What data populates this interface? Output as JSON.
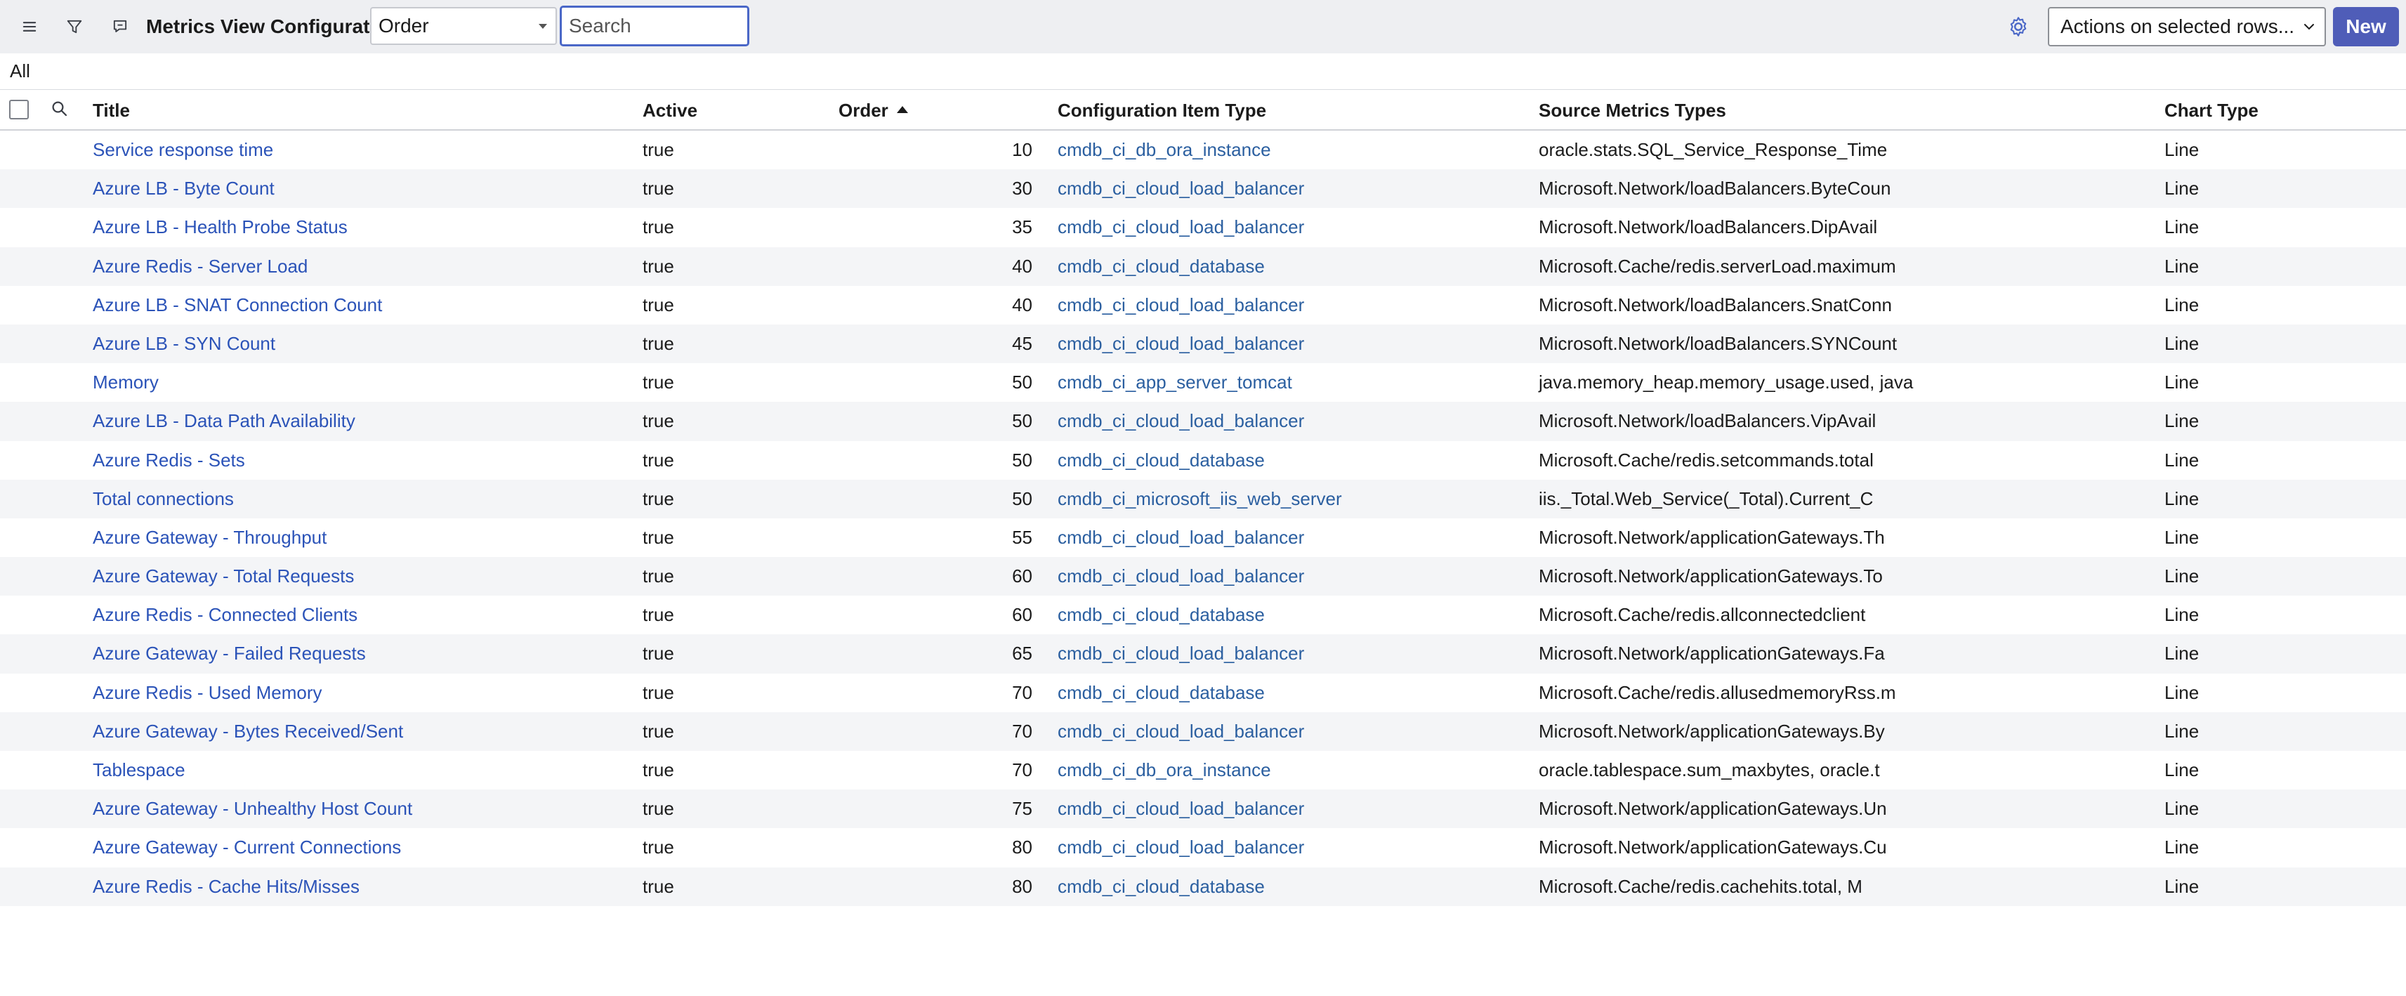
{
  "toolbar": {
    "list_title": "Metrics View Configuration",
    "search_field": "Order",
    "search_placeholder": "Search",
    "actions_label": "Actions on selected rows...",
    "new_label": "New"
  },
  "breadcrumb": "All",
  "columns": {
    "title": "Title",
    "active": "Active",
    "order": "Order",
    "ci_type": "Configuration Item Type",
    "source_metrics": "Source Metrics Types",
    "chart_type": "Chart Type"
  },
  "colors": {
    "accent": "#4f5db8",
    "link": "#2b53b8",
    "toolbar_bg": "#eeeff2",
    "row_alt": "#f4f5f7"
  },
  "rows": [
    {
      "title": "Service response time",
      "active": "true",
      "order": "10",
      "ci_type": "cmdb_ci_db_ora_instance",
      "source": "oracle.stats.SQL_Service_Response_Time",
      "chart": "Line"
    },
    {
      "title": "Azure LB - Byte Count",
      "active": "true",
      "order": "30",
      "ci_type": "cmdb_ci_cloud_load_balancer",
      "source": "Microsoft.Network/loadBalancers.ByteCoun",
      "chart": "Line"
    },
    {
      "title": "Azure LB - Health Probe Status",
      "active": "true",
      "order": "35",
      "ci_type": "cmdb_ci_cloud_load_balancer",
      "source": "Microsoft.Network/loadBalancers.DipAvail",
      "chart": "Line"
    },
    {
      "title": "Azure Redis - Server Load",
      "active": "true",
      "order": "40",
      "ci_type": "cmdb_ci_cloud_database",
      "source": "Microsoft.Cache/redis.serverLoad.maximum",
      "chart": "Line"
    },
    {
      "title": "Azure LB - SNAT Connection Count",
      "active": "true",
      "order": "40",
      "ci_type": "cmdb_ci_cloud_load_balancer",
      "source": "Microsoft.Network/loadBalancers.SnatConn",
      "chart": "Line"
    },
    {
      "title": "Azure LB - SYN Count",
      "active": "true",
      "order": "45",
      "ci_type": "cmdb_ci_cloud_load_balancer",
      "source": "Microsoft.Network/loadBalancers.SYNCount",
      "chart": "Line"
    },
    {
      "title": "Memory",
      "active": "true",
      "order": "50",
      "ci_type": "cmdb_ci_app_server_tomcat",
      "source": "java.memory_heap.memory_usage.used, java",
      "chart": "Line"
    },
    {
      "title": "Azure LB - Data Path Availability",
      "active": "true",
      "order": "50",
      "ci_type": "cmdb_ci_cloud_load_balancer",
      "source": "Microsoft.Network/loadBalancers.VipAvail",
      "chart": "Line"
    },
    {
      "title": "Azure Redis - Sets",
      "active": "true",
      "order": "50",
      "ci_type": "cmdb_ci_cloud_database",
      "source": "Microsoft.Cache/redis.setcommands.total",
      "chart": "Line"
    },
    {
      "title": "Total connections",
      "active": "true",
      "order": "50",
      "ci_type": "cmdb_ci_microsoft_iis_web_server",
      "source": "iis._Total.Web_Service(_Total).Current_C",
      "chart": "Line"
    },
    {
      "title": "Azure Gateway - Throughput",
      "active": "true",
      "order": "55",
      "ci_type": "cmdb_ci_cloud_load_balancer",
      "source": "Microsoft.Network/applicationGateways.Th",
      "chart": "Line"
    },
    {
      "title": "Azure Gateway - Total Requests",
      "active": "true",
      "order": "60",
      "ci_type": "cmdb_ci_cloud_load_balancer",
      "source": "Microsoft.Network/applicationGateways.To",
      "chart": "Line"
    },
    {
      "title": "Azure Redis - Connected Clients",
      "active": "true",
      "order": "60",
      "ci_type": "cmdb_ci_cloud_database",
      "source": "Microsoft.Cache/redis.allconnectedclient",
      "chart": "Line"
    },
    {
      "title": "Azure Gateway - Failed Requests",
      "active": "true",
      "order": "65",
      "ci_type": "cmdb_ci_cloud_load_balancer",
      "source": "Microsoft.Network/applicationGateways.Fa",
      "chart": "Line"
    },
    {
      "title": "Azure Redis - Used Memory",
      "active": "true",
      "order": "70",
      "ci_type": "cmdb_ci_cloud_database",
      "source": "Microsoft.Cache/redis.allusedmemoryRss.m",
      "chart": "Line"
    },
    {
      "title": "Azure Gateway - Bytes Received/Sent",
      "active": "true",
      "order": "70",
      "ci_type": "cmdb_ci_cloud_load_balancer",
      "source": "Microsoft.Network/applicationGateways.By",
      "chart": "Line"
    },
    {
      "title": "Tablespace",
      "active": "true",
      "order": "70",
      "ci_type": "cmdb_ci_db_ora_instance",
      "source": "oracle.tablespace.sum_maxbytes, oracle.t",
      "chart": "Line"
    },
    {
      "title": "Azure Gateway - Unhealthy Host Count",
      "active": "true",
      "order": "75",
      "ci_type": "cmdb_ci_cloud_load_balancer",
      "source": "Microsoft.Network/applicationGateways.Un",
      "chart": "Line"
    },
    {
      "title": "Azure Gateway - Current Connections",
      "active": "true",
      "order": "80",
      "ci_type": "cmdb_ci_cloud_load_balancer",
      "source": "Microsoft.Network/applicationGateways.Cu",
      "chart": "Line"
    },
    {
      "title": "Azure Redis - Cache Hits/Misses",
      "active": "true",
      "order": "80",
      "ci_type": "cmdb_ci_cloud_database",
      "source": "Microsoft.Cache/redis.cachehits.total, M",
      "chart": "Line"
    }
  ]
}
